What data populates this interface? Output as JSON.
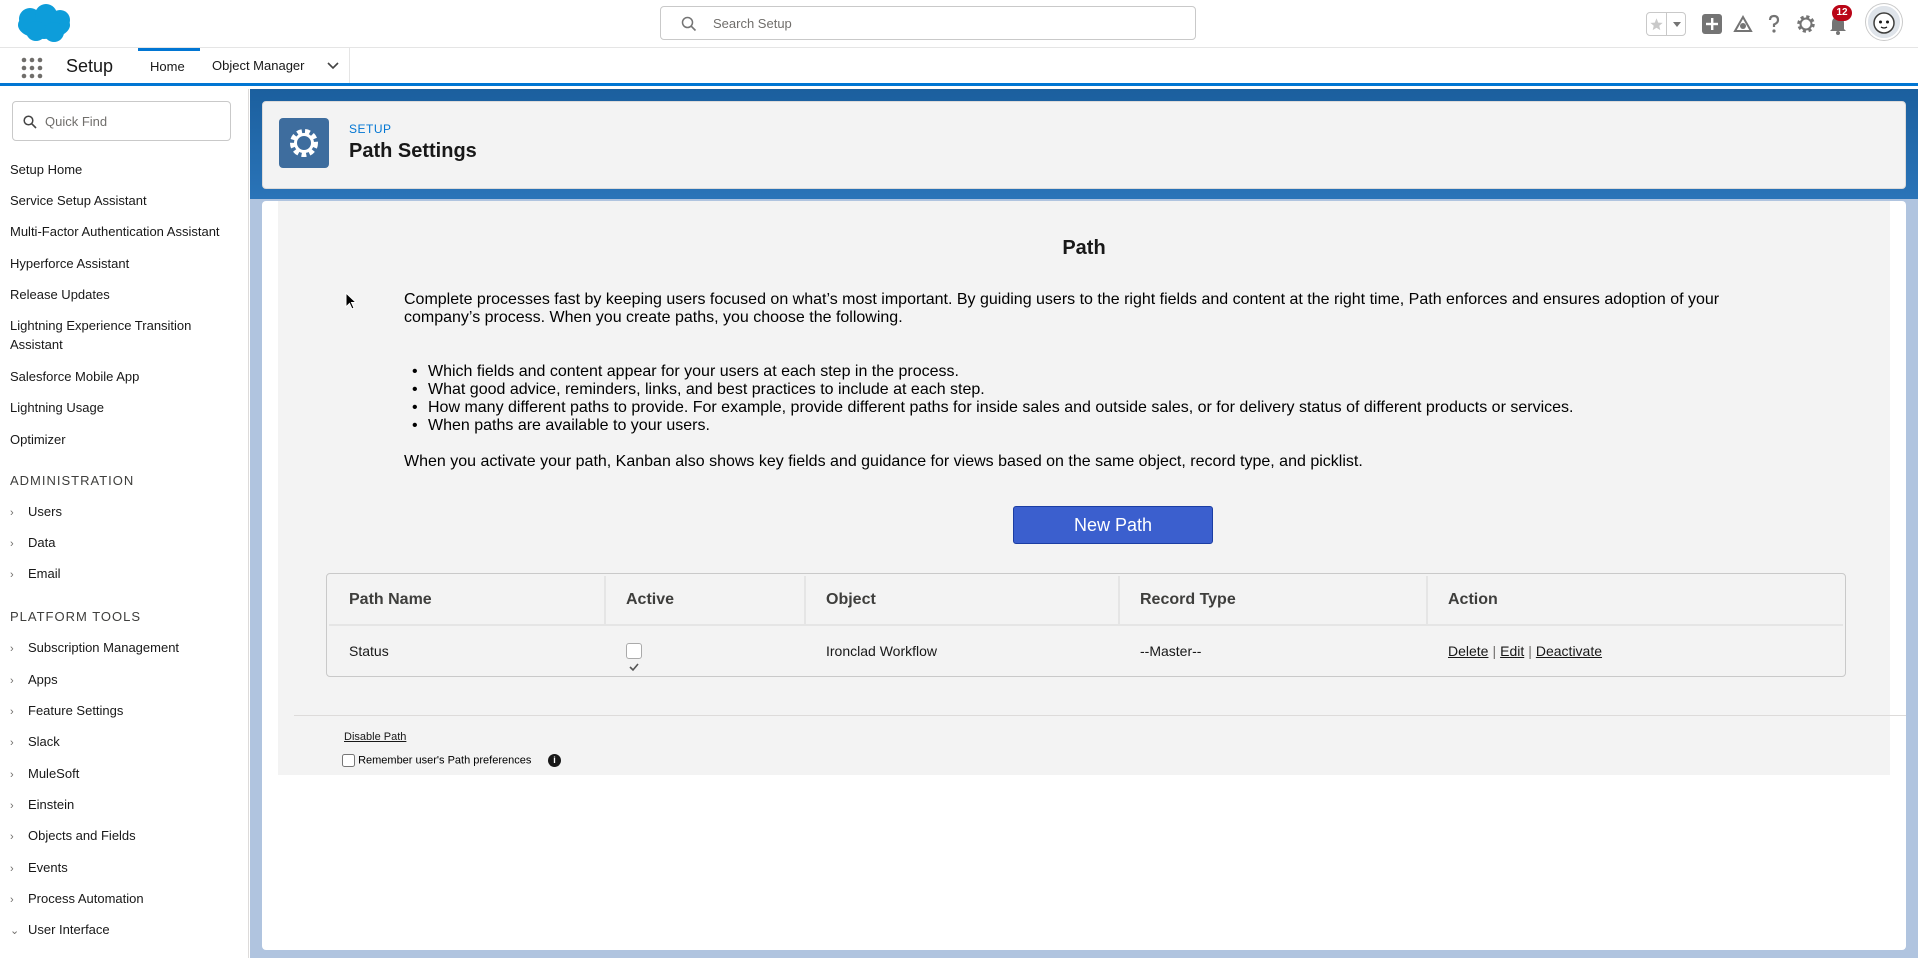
{
  "header": {
    "search_placeholder": "Search Setup",
    "notifications_count": "12",
    "icons": [
      "salesforce-cloud-logo",
      "star-icon",
      "chevron-down-icon",
      "add-icon",
      "trailhead-icon",
      "help-icon",
      "gear-icon",
      "bell-icon",
      "user-avatar"
    ]
  },
  "context": {
    "app_name": "Setup",
    "tabs": [
      {
        "label": "Home",
        "active": true
      },
      {
        "label": "Object Manager",
        "active": false
      }
    ]
  },
  "sidebar": {
    "quick_find_placeholder": "Quick Find",
    "links": [
      "Setup Home",
      "Service Setup Assistant",
      "Multi-Factor Authentication Assistant",
      "Hyperforce Assistant",
      "Release Updates",
      "Lightning Experience Transition Assistant",
      "Salesforce Mobile App",
      "Lightning Usage",
      "Optimizer"
    ],
    "sections": [
      {
        "title": "ADMINISTRATION",
        "items": [
          "Users",
          "Data",
          "Email"
        ]
      },
      {
        "title": "PLATFORM TOOLS",
        "items": [
          "Subscription Management",
          "Apps",
          "Feature Settings",
          "Slack",
          "MuleSoft",
          "Einstein",
          "Objects and Fields",
          "Events",
          "Process Automation",
          "User Interface"
        ]
      }
    ]
  },
  "page": {
    "overline": "SETUP",
    "title": "Path Settings"
  },
  "path": {
    "heading": "Path",
    "intro": "Complete processes fast by keeping users focused on what’s most important. By guiding users to the right fields and content at the right time, Path enforces and ensures adoption of your company’s process. When you create paths, you choose the following.",
    "bullets": [
      "Which fields and content appear for your users at each step in the process.",
      "What good advice, reminders, links, and best practices to include at each step.",
      "How many different paths to provide. For example, provide different paths for inside sales and outside sales, or for delivery status of different products or services.",
      "When paths are available to your users."
    ],
    "kanban": "When you activate your path, Kanban also shows key fields and guidance for views based on the same object, record type, and picklist.",
    "new_button": "New Path",
    "table": {
      "headers": [
        "Path Name",
        "Active",
        "Object",
        "Record Type",
        "Action"
      ],
      "rows": [
        {
          "name": "Status",
          "active": true,
          "object": "Ironclad Workflow",
          "record_type": "--Master--",
          "actions": [
            "Delete",
            "Edit",
            "Deactivate"
          ]
        }
      ]
    },
    "disable_link": "Disable Path",
    "remember_label": "Remember user's Path preferences",
    "info_glyph": "i"
  },
  "colors": {
    "brand": "#0176d3",
    "button": "#3b5fce",
    "banner": "#1b5f9e",
    "badge": "#ba0517"
  }
}
